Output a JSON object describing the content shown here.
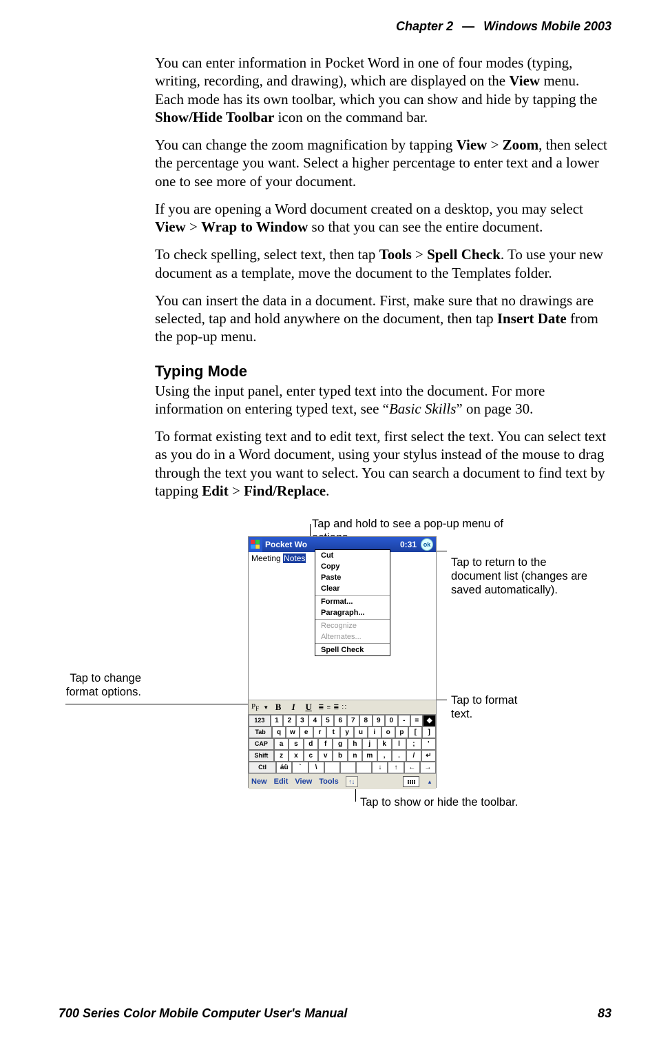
{
  "header": {
    "chapter_label": "Chapter",
    "chapter_num": "2",
    "dash": "—",
    "title": "Windows Mobile 2003"
  },
  "body": {
    "p1": {
      "t1": "You can enter information in Pocket Word in one of four modes (typing, writing, recording, and drawing), which are displayed on the ",
      "b1": "View",
      "t2": " menu. Each mode has its own toolbar, which you can show and hide by tapping the ",
      "b2": "Show/Hide Toolbar",
      "t3": " icon on the command bar."
    },
    "p2": {
      "t1": "You can change the zoom magnification by tapping ",
      "b1": "View",
      "t2": " > ",
      "b2": "Zoom",
      "t3": ", then select the percentage you want. Select a higher percentage to enter text and a lower one to see more of your document."
    },
    "p3": {
      "t1": "If you are opening a Word document created on a desktop, you may select ",
      "b1": "View",
      "t2": " > ",
      "b2": "Wrap to Window",
      "t3": " so that you can see the entire document."
    },
    "p4": {
      "t1": "To check spelling, select text, then tap ",
      "b1": "Tools",
      "t2": " > ",
      "b2": "Spell Check",
      "t3": ". To use your new document as a template, move the document to the Templates folder."
    },
    "p5": {
      "t1": "You can insert the data in a document. First, make sure that no drawings are selected, tap and hold anywhere on the document, then tap ",
      "b1": "Insert Date",
      "t2": " from the pop-up menu."
    },
    "h2": "Typing Mode",
    "p6": {
      "t1": "Using the input panel, enter typed text into the document. For more information on entering typed text, see “",
      "i1": "Basic Skills",
      "t2": "” on page 30."
    },
    "p7": {
      "t1": "To format existing text and to edit text, first select the text. You can select text as you do in a Word document, using your stylus instead of the mouse to drag through the text you want to select. You can search a document to find text by tapping ",
      "b1": "Edit",
      "t2": " > ",
      "b2": "Find/Replace",
      "t3": "."
    }
  },
  "callouts": {
    "top": "Tap and hold to see a pop-up menu of actions.",
    "right_top": "Tap to return to the document list (changes are saved automatically).",
    "left": "Tap to change format options.",
    "right_mid": "Tap to format text.",
    "bottom": "Tap to show or hide the toolbar."
  },
  "shot": {
    "titlebar": {
      "app": "Pocket Wo",
      "time": "0:31",
      "ok": "ok"
    },
    "doc": {
      "line_prefix": "Meeting ",
      "line_sel": "Notes"
    },
    "popup": {
      "cut": "Cut",
      "copy": "Copy",
      "paste": "Paste",
      "clear": "Clear",
      "format": "Format...",
      "paragraph": "Paragraph...",
      "recognize": "Recognize",
      "alternates": "Alternates...",
      "spell": "Spell Check"
    },
    "fmt": {
      "pf": "P",
      "pf2": "F",
      "b": "B",
      "i": "I",
      "u": "U"
    },
    "sip": {
      "r0": [
        "123",
        "1",
        "2",
        "3",
        "4",
        "5",
        "6",
        "7",
        "8",
        "9",
        "0",
        "-",
        "=",
        "◆"
      ],
      "r1": [
        "Tab",
        "q",
        "w",
        "e",
        "r",
        "t",
        "y",
        "u",
        "i",
        "o",
        "p",
        "[",
        "]"
      ],
      "r2": [
        "CAP",
        "a",
        "s",
        "d",
        "f",
        "g",
        "h",
        "j",
        "k",
        "l",
        ";",
        "'"
      ],
      "r3": [
        "Shift",
        "z",
        "x",
        "c",
        "v",
        "b",
        "n",
        "m",
        ",",
        ".",
        "/",
        "↵"
      ],
      "r4": [
        "Ctl",
        "áü",
        "`",
        "\\",
        " ",
        " ",
        " ",
        "↓",
        "↑",
        "←",
        "→"
      ]
    },
    "menubar": {
      "new": "New",
      "edit": "Edit",
      "view": "View",
      "tools": "Tools"
    }
  },
  "footer": {
    "left": "700 Series Color Mobile Computer User's Manual",
    "right": "83"
  }
}
